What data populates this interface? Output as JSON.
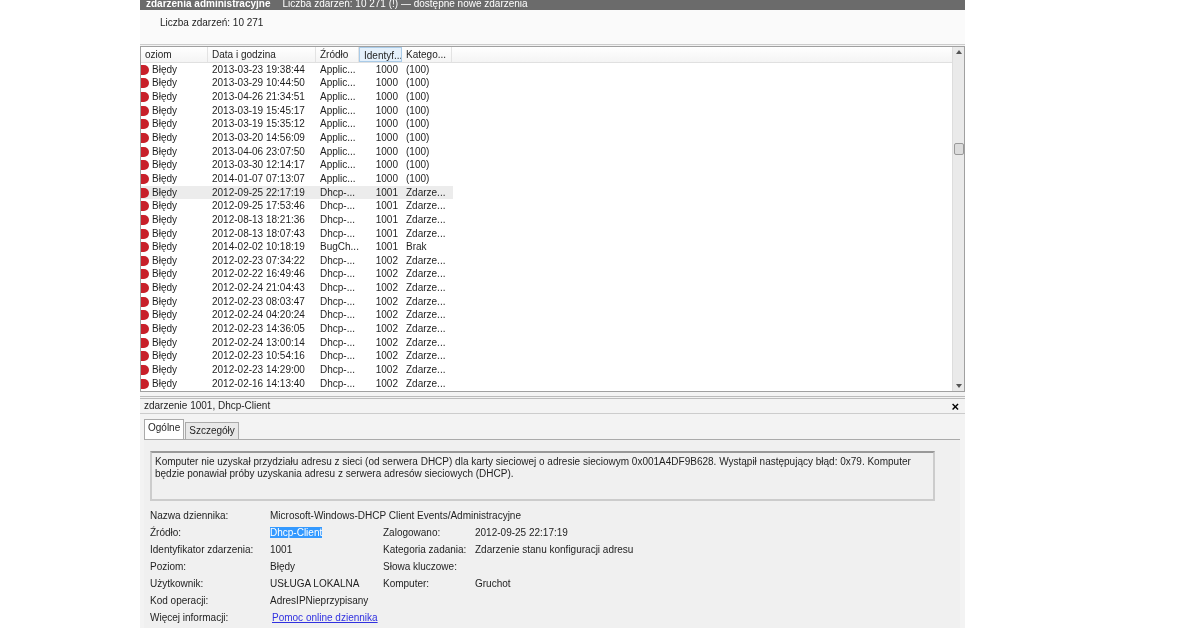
{
  "title_bar": {
    "title": "zdarzenia administracyjne",
    "status": "Liczba zdarzeń: 10 271 (!) — dostępne nowe zdarzenia"
  },
  "event_count": "Liczba zdarzeń: 10 271",
  "table": {
    "columns": [
      {
        "label": "oziom",
        "sorted": false
      },
      {
        "label": "Data i godzina",
        "sorted": false
      },
      {
        "label": "Źródło",
        "sorted": false
      },
      {
        "label": "Identyf...",
        "sorted": true
      },
      {
        "label": "Katego...",
        "sorted": false
      }
    ],
    "rows": [
      {
        "level": "Błędy",
        "date": "2013-03-23 19:38:44",
        "source": "Applic...",
        "id": "1000",
        "category": "(100)",
        "selected": false
      },
      {
        "level": "Błędy",
        "date": "2013-03-29 10:44:50",
        "source": "Applic...",
        "id": "1000",
        "category": "(100)",
        "selected": false
      },
      {
        "level": "Błędy",
        "date": "2013-04-26 21:34:51",
        "source": "Applic...",
        "id": "1000",
        "category": "(100)",
        "selected": false
      },
      {
        "level": "Błędy",
        "date": "2013-03-19 15:45:17",
        "source": "Applic...",
        "id": "1000",
        "category": "(100)",
        "selected": false
      },
      {
        "level": "Błędy",
        "date": "2013-03-19 15:35:12",
        "source": "Applic...",
        "id": "1000",
        "category": "(100)",
        "selected": false
      },
      {
        "level": "Błędy",
        "date": "2013-03-20 14:56:09",
        "source": "Applic...",
        "id": "1000",
        "category": "(100)",
        "selected": false
      },
      {
        "level": "Błędy",
        "date": "2013-04-06 23:07:50",
        "source": "Applic...",
        "id": "1000",
        "category": "(100)",
        "selected": false
      },
      {
        "level": "Błędy",
        "date": "2013-03-30 12:14:17",
        "source": "Applic...",
        "id": "1000",
        "category": "(100)",
        "selected": false
      },
      {
        "level": "Błędy",
        "date": "2014-01-07 07:13:07",
        "source": "Applic...",
        "id": "1000",
        "category": "(100)",
        "selected": false
      },
      {
        "level": "Błędy",
        "date": "2012-09-25 22:17:19",
        "source": "Dhcp-...",
        "id": "1001",
        "category": "Zdarze...",
        "selected": true
      },
      {
        "level": "Błędy",
        "date": "2012-09-25 17:53:46",
        "source": "Dhcp-...",
        "id": "1001",
        "category": "Zdarze...",
        "selected": false
      },
      {
        "level": "Błędy",
        "date": "2012-08-13 18:21:36",
        "source": "Dhcp-...",
        "id": "1001",
        "category": "Zdarze...",
        "selected": false
      },
      {
        "level": "Błędy",
        "date": "2012-08-13 18:07:43",
        "source": "Dhcp-...",
        "id": "1001",
        "category": "Zdarze...",
        "selected": false
      },
      {
        "level": "Błędy",
        "date": "2014-02-02 10:18:19",
        "source": "BugCh...",
        "id": "1001",
        "category": "Brak",
        "selected": false
      },
      {
        "level": "Błędy",
        "date": "2012-02-23 07:34:22",
        "source": "Dhcp-...",
        "id": "1002",
        "category": "Zdarze...",
        "selected": false
      },
      {
        "level": "Błędy",
        "date": "2012-02-22 16:49:46",
        "source": "Dhcp-...",
        "id": "1002",
        "category": "Zdarze...",
        "selected": false
      },
      {
        "level": "Błędy",
        "date": "2012-02-24 21:04:43",
        "source": "Dhcp-...",
        "id": "1002",
        "category": "Zdarze...",
        "selected": false
      },
      {
        "level": "Błędy",
        "date": "2012-02-23 08:03:47",
        "source": "Dhcp-...",
        "id": "1002",
        "category": "Zdarze...",
        "selected": false
      },
      {
        "level": "Błędy",
        "date": "2012-02-24 04:20:24",
        "source": "Dhcp-...",
        "id": "1002",
        "category": "Zdarze...",
        "selected": false
      },
      {
        "level": "Błędy",
        "date": "2012-02-23 14:36:05",
        "source": "Dhcp-...",
        "id": "1002",
        "category": "Zdarze...",
        "selected": false
      },
      {
        "level": "Błędy",
        "date": "2012-02-24 13:00:14",
        "source": "Dhcp-...",
        "id": "1002",
        "category": "Zdarze...",
        "selected": false
      },
      {
        "level": "Błędy",
        "date": "2012-02-23 10:54:16",
        "source": "Dhcp-...",
        "id": "1002",
        "category": "Zdarze...",
        "selected": false
      },
      {
        "level": "Błędy",
        "date": "2012-02-23 14:29:00",
        "source": "Dhcp-...",
        "id": "1002",
        "category": "Zdarze...",
        "selected": false
      },
      {
        "level": "Błędy",
        "date": "2012-02-16 14:13:40",
        "source": "Dhcp-...",
        "id": "1002",
        "category": "Zdarze...",
        "selected": false
      }
    ]
  },
  "details": {
    "title": "zdarzenie 1001, Dhcp-Client",
    "close": "×",
    "tabs": [
      {
        "label": "Ogólne",
        "selected": true
      },
      {
        "label": "Szczegóły",
        "selected": false
      }
    ],
    "description": "Komputer nie uzyskał przydziału adresu z sieci (od serwera DHCP) dla karty sieciowej o adresie sieciowym 0x001A4DF9B628. Wystąpił następujący błąd: 0x79. Komputer będzie ponawiał próby uzyskania adresu z serwera adresów sieciowych (DHCP).",
    "properties": [
      {
        "left": {
          "label": "Nazwa dziennika:",
          "value": "Microsoft-Windows-DHCP Client Events/Administracyjne",
          "kind": "text"
        }
      },
      {
        "left": {
          "label": "Źródło:",
          "value": "Dhcp-Client",
          "kind": "text",
          "highlighted": true
        },
        "right": {
          "label": "Zalogowano:",
          "value": "2012-09-25 22:17:19"
        }
      },
      {
        "left": {
          "label": "Identyfikator zdarzenia:",
          "value": "1001",
          "kind": "text"
        },
        "right": {
          "label": "Kategoria zadania:",
          "value": "Zdarzenie stanu konfiguracji adresu"
        }
      },
      {
        "left": {
          "label": "Poziom:",
          "value": "Błędy",
          "kind": "text"
        },
        "right": {
          "label": "Słowa kluczowe:"
        }
      },
      {
        "left": {
          "label": "Użytkownik:",
          "value": "USŁUGA LOKALNA",
          "kind": "text"
        },
        "right": {
          "label": "Komputer:",
          "value": "Gruchot"
        }
      },
      {
        "left": {
          "label": "Kod operacji:",
          "value": "AdresIPNieprzypisany",
          "kind": "text"
        }
      },
      {
        "left": {
          "label": "Więcej informacji:",
          "value": "Pomoc online dziennika",
          "kind": "link"
        }
      }
    ]
  }
}
